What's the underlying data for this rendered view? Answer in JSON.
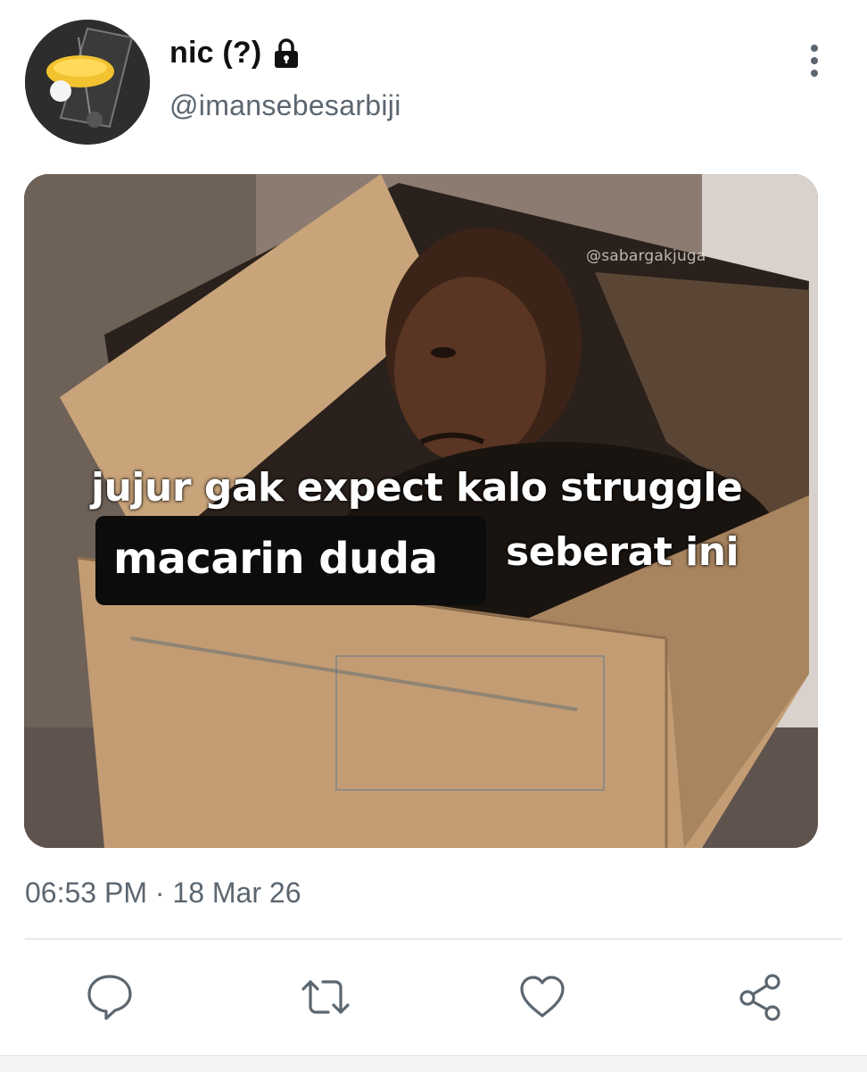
{
  "user": {
    "display_name": "nic (?)",
    "handle": "@imansebesarbiji",
    "avatar_icon": "avatar",
    "protected_icon": "lock-icon"
  },
  "menu": {
    "icon": "more-vertical-icon"
  },
  "media": {
    "watermark": "@sabargakjuga",
    "caption_line_1": "jujur gak expect kalo struggle",
    "caption_line_2": "seberat ini",
    "overlay_text": "macarin duda"
  },
  "meta": {
    "timestamp": "06:53 PM · 18 Mar 26"
  },
  "actions": [
    {
      "name": "reply",
      "icon": "reply-icon"
    },
    {
      "name": "retweet",
      "icon": "retweet-icon"
    },
    {
      "name": "like",
      "icon": "heart-icon"
    },
    {
      "name": "share",
      "icon": "share-icon"
    }
  ],
  "colors": {
    "text_primary": "#111111",
    "text_secondary": "#5b6670",
    "icon": "#5b6670",
    "divider": "#e7e9eb"
  }
}
